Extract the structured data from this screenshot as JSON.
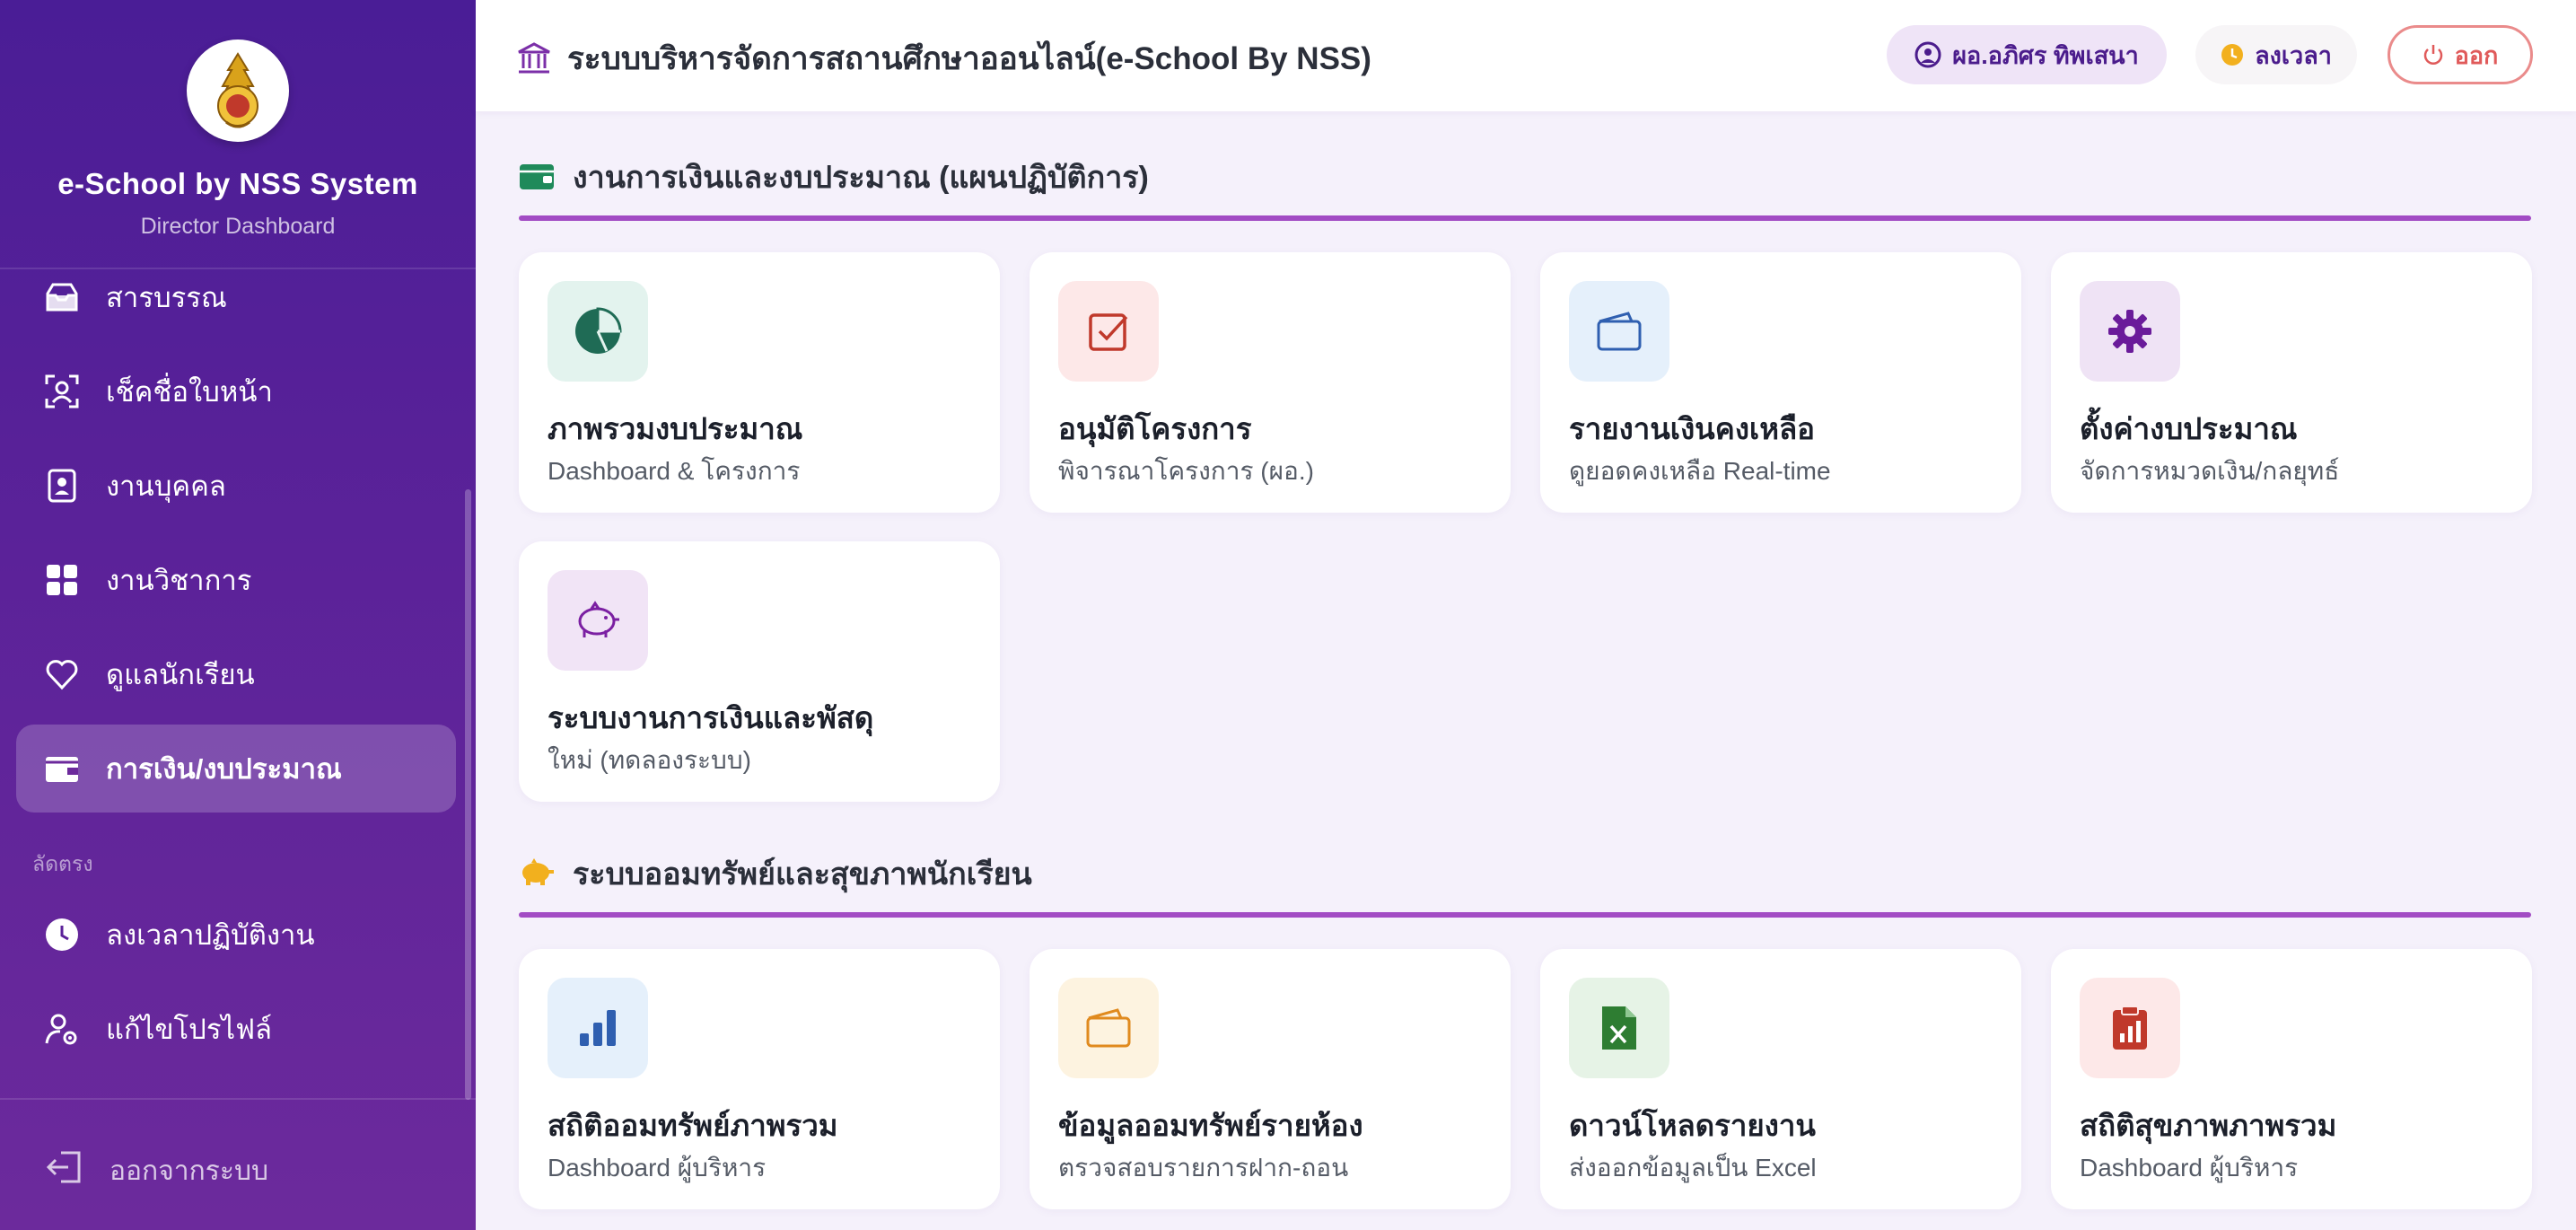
{
  "brand": {
    "title": "e-School by NSS System",
    "subtitle": "Director Dashboard"
  },
  "sidebar": {
    "items": [
      {
        "label": "สารบรรณ",
        "icon": "inbox-icon"
      },
      {
        "label": "เช็คชื่อใบหน้า",
        "icon": "face-scan-icon"
      },
      {
        "label": "งานบุคคล",
        "icon": "id-badge-icon"
      },
      {
        "label": "งานวิชาการ",
        "icon": "grid-icon"
      },
      {
        "label": "ดูแลนักเรียน",
        "icon": "heart-icon"
      },
      {
        "label": "การเงิน/งบประมาณ",
        "icon": "wallet-icon",
        "active": true
      }
    ],
    "section_label": "ลัดตรง",
    "shortcuts": [
      {
        "label": "ลงเวลาปฏิบัติงาน",
        "icon": "clock-icon"
      },
      {
        "label": "แก้ไขโปรไฟล์",
        "icon": "user-gear-icon"
      }
    ],
    "logout_label": "ออกจากระบบ"
  },
  "header": {
    "title": "ระบบบริหารจัดการสถานศึกษาออนไลน์(e-School By NSS)",
    "user_label": "ผอ.อภิศร ทิพเสนา",
    "time_label": "ลงเวลา",
    "logout_label": "ออก"
  },
  "sections": [
    {
      "title": "งานการเงินและงบประมาณ (แผนปฏิบัติการ)",
      "icon": "wallet-icon",
      "cards": [
        {
          "title": "ภาพรวมงบประมาณ",
          "subtitle": "Dashboard & โครงการ",
          "icon": "pie-chart-icon",
          "icon_color": "#1f6b55",
          "bg": "#e3f3ee"
        },
        {
          "title": "อนุมัติโครงการ",
          "subtitle": "พิจารณาโครงการ (ผอ.)",
          "icon": "check-square-icon",
          "icon_color": "#c0392b",
          "bg": "#fde8e8"
        },
        {
          "title": "รายงานเงินคงเหลือ",
          "subtitle": "ดูยอดคงเหลือ Real-time",
          "icon": "wallet-outline-icon",
          "icon_color": "#2f5fb0",
          "bg": "#e5f0fb"
        },
        {
          "title": "ตั้งค่างบประมาณ",
          "subtitle": "จัดการหมวดเงิน/กลยุทธ์",
          "icon": "gear-icon",
          "icon_color": "#6a1b9a",
          "bg": "#efe3f5"
        },
        {
          "title": "ระบบงานการเงินและพัสดุ",
          "subtitle": "ใหม่ (ทดลองระบบ)",
          "icon": "piggy-bank-icon",
          "icon_color": "#7b1fa2",
          "bg": "#f1e4f6"
        }
      ]
    },
    {
      "title": "ระบบออมทรัพย์และสุขภาพนักเรียน",
      "icon": "piggy-bank-icon",
      "cards": [
        {
          "title": "สถิติออมทรัพย์ภาพรวม",
          "subtitle": "Dashboard ผู้บริหาร",
          "icon": "bar-chart-icon",
          "icon_color": "#2f5fb0",
          "bg": "#e5f0fb"
        },
        {
          "title": "ข้อมูลออมทรัพย์รายห้อง",
          "subtitle": "ตรวจสอบรายการฝาก-ถอน",
          "icon": "wallet-outline-icon",
          "icon_color": "#e08a1e",
          "bg": "#fdf3e0"
        },
        {
          "title": "ดาวน์โหลดรายงาน",
          "subtitle": "ส่งออกข้อมูลเป็น Excel",
          "icon": "excel-file-icon",
          "icon_color": "#2e7d32",
          "bg": "#e6f3e6"
        },
        {
          "title": "สถิติสุขภาพภาพรวม",
          "subtitle": "Dashboard ผู้บริหาร",
          "icon": "clipboard-chart-icon",
          "icon_color": "#c0392b",
          "bg": "#fde8e8"
        }
      ]
    }
  ]
}
